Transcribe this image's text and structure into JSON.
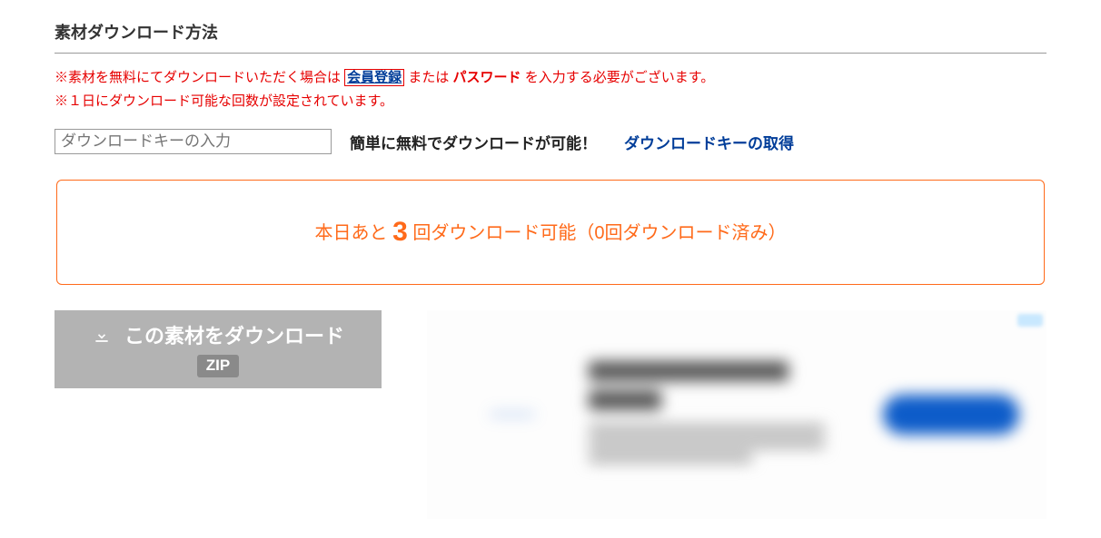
{
  "heading": "素材ダウンロード方法",
  "notice": {
    "prefix": "※素材を無料にてダウンロードいただく場合は ",
    "register": "会員登録",
    "mid": " または ",
    "password": "パスワード",
    "suffix": " を入力する必要がございます。",
    "line2": "※１日にダウンロード可能な回数が設定されています。"
  },
  "key": {
    "placeholder": "ダウンロードキーの入力",
    "info": "簡単に無料でダウンロードが可能！",
    "get": "ダウンロードキーの取得"
  },
  "quota": {
    "before": "本日あと ",
    "count": "3",
    "after": " 回ダウンロード可能（0回ダウンロード済み）"
  },
  "download": {
    "label": "この素材をダウンロード",
    "format": "ZIP"
  }
}
